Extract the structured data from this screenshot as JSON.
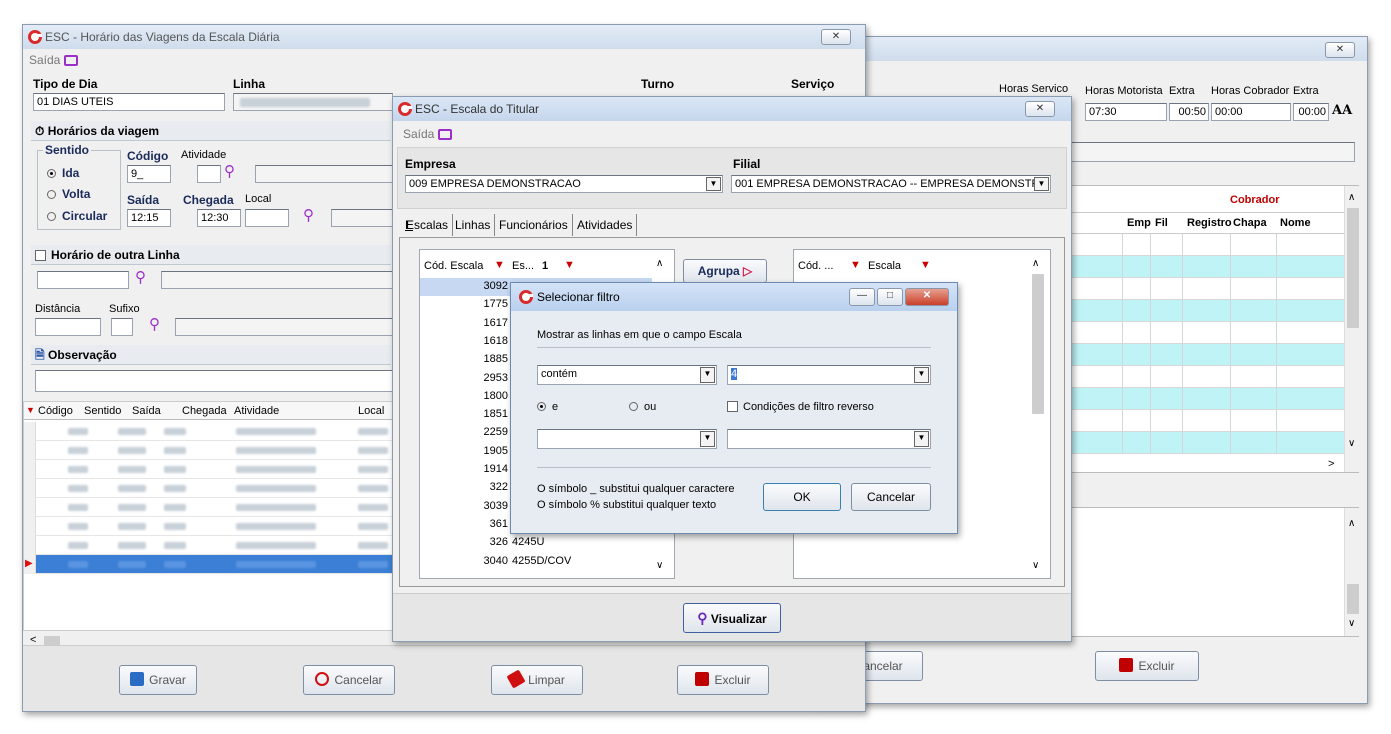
{
  "bg_window": {
    "close": "✕",
    "header": {
      "horas_servico": "Horas Servico",
      "horas_motorista": "Horas Motorista",
      "extra1": "Extra",
      "horas_cobrador": "Horas Cobrador",
      "extra2": "Extra",
      "aa": "AA"
    },
    "values": {
      "motorista": "07:30",
      "extra1": "00:50",
      "cobrador": "00:00",
      "extra2": "00:00"
    },
    "grid": {
      "group": "Cobrador",
      "cols": [
        "Emp",
        "Fil",
        "Registro",
        "Chapa",
        "Nome"
      ],
      "row_fill": [
        "#ffffff",
        "#bff3f6"
      ]
    },
    "buttons": {
      "cancelar": "ancelar",
      "excluir": "Excluir"
    }
  },
  "main_window": {
    "title": "ESC - Horário das Viagens da Escala Diária",
    "menu_saida": "Saída",
    "close": "✕",
    "tipo_dia_label": "Tipo de Dia",
    "linha_label": "Linha",
    "turno_label": "Turno",
    "servico_label": "Serviço",
    "tipo_dia_value": "01 DIAS UTEIS",
    "horarios_title": "Horários da viagem",
    "sentido_label": "Sentido",
    "ida": "Ida",
    "volta": "Volta",
    "circular": "Circular",
    "codigo_label": "Código",
    "codigo_value": "9_",
    "atividade_label": "Atividade",
    "saida_label": "Saída",
    "chegada_label": "Chegada",
    "local_label": "Local",
    "saida_value": "12:15",
    "chegada_value": "12:30",
    "outra_linha": "Horário de outra Linha",
    "distancia_label": "Distância",
    "sufixo_label": "Sufixo",
    "observacao": "Observação",
    "grid_cols": [
      "Código",
      "Sentido",
      "Saída",
      "Chegada",
      "Atividade",
      "Local"
    ],
    "scroll_left": "<",
    "buttons": {
      "gravar": "Gravar",
      "cancelar": "Cancelar",
      "limpar": "Limpar",
      "excluir": "Excluir"
    }
  },
  "titular_window": {
    "title": "ESC - Escala do Titular",
    "menu_saida": "Saída",
    "close": "✕",
    "empresa_label": "Empresa",
    "filial_label": "Filial",
    "empresa_value": "009 EMPRESA DEMONSTRACAO",
    "filial_value": "001 EMPRESA DEMONSTRACAO -- EMPRESA DEMONSTR",
    "tabs": [
      "Escalas",
      "Linhas",
      "Funcionários",
      "Atividades"
    ],
    "left_grid_cols": [
      "Cód. Escala",
      "Es...",
      "1"
    ],
    "codes": [
      "3092",
      "1775",
      "1617",
      "1618",
      "1885",
      "2953",
      "1800",
      "1851",
      "2259",
      "1905",
      "1914",
      "322",
      "3039",
      "361",
      "326",
      "3040"
    ],
    "escalas": [
      "",
      "",
      "",
      "",
      "",
      "",
      "",
      "",
      "",
      "",
      "",
      "",
      "",
      "",
      "4245U",
      "4255D/COV"
    ],
    "agrupa": "Agrupa",
    "right_grid_cols": [
      "Cód. ...",
      "Escala"
    ],
    "visualizar": "Visualizar"
  },
  "filter_dialog": {
    "title": "Selecionar filtro",
    "prompt": "Mostrar as linhas em que o campo Escala",
    "operator": "contém",
    "value": "4",
    "e_label": "e",
    "ou_label": "ou",
    "reverse": "Condições de filtro reverso",
    "hint1": "O símbolo _ substitui qualquer caractere",
    "hint2": "O símbolo % substitui qualquer texto",
    "ok": "OK",
    "cancelar": "Cancelar"
  }
}
